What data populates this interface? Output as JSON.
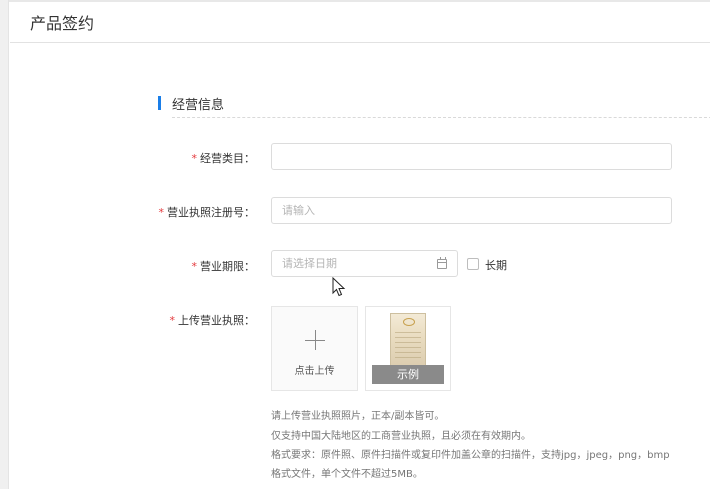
{
  "page": {
    "title": "产品签约"
  },
  "section": {
    "title": "经营信息"
  },
  "form": {
    "required_mark": "*",
    "category": {
      "label": "经营类目：",
      "value": ""
    },
    "license_no": {
      "label": "营业执照注册号：",
      "placeholder": "请输入"
    },
    "term": {
      "label": "营业期限：",
      "placeholder": "请选择日期",
      "long_term_label": "长期",
      "long_term_checked": false
    },
    "upload": {
      "label": "上传营业执照：",
      "upload_text": "点击上传",
      "sample_label": "示例",
      "hints": [
        "请上传营业执照照片，正本/副本皆可。",
        "仅支持中国大陆地区的工商营业执照，且必须在有效期内。",
        "格式要求：原件照、原件扫描件或复印件加盖公章的扫描件，支持jpg，jpeg，png，bmp",
        "格式文件，单个文件不超过5MB。"
      ]
    }
  },
  "icons": {
    "calendar": "calendar-icon",
    "plus": "plus-icon",
    "cursor": "mouse-pointer-icon"
  },
  "colors": {
    "accent": "#1a7ee8",
    "required": "#e4393c",
    "sample_tag": "#8a8a8a"
  }
}
